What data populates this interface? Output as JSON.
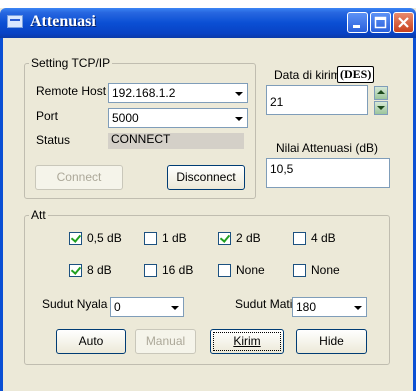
{
  "window": {
    "title": "Attenuasi",
    "controls": {
      "minimize": "minimize-icon",
      "maximize": "maximize-icon",
      "close": "close-icon"
    }
  },
  "tcp": {
    "legend": "Setting TCP/IP",
    "remote_host_label": "Remote Host",
    "remote_host_value": "192.168.1.2",
    "port_label": "Port",
    "port_value": "5000",
    "status_label": "Status",
    "status_value": "CONNECT",
    "connect_label": "Connect",
    "disconnect_label": "Disconnect"
  },
  "data_kirim": {
    "label": "Data di kirim",
    "badge": "(DES)",
    "value": "21"
  },
  "nilai": {
    "label": "Nilai Attenuasi (dB)",
    "value": "10,5"
  },
  "att": {
    "legend": "Att",
    "checks": [
      {
        "label": "0,5 dB",
        "checked": true
      },
      {
        "label": "1 dB",
        "checked": false
      },
      {
        "label": "2 dB",
        "checked": true
      },
      {
        "label": "4 dB",
        "checked": false
      },
      {
        "label": "8 dB",
        "checked": true
      },
      {
        "label": "16 dB",
        "checked": false
      },
      {
        "label": "None",
        "checked": false
      },
      {
        "label": "None",
        "checked": false
      }
    ],
    "sudut_nyala_label": "Sudut Nyala",
    "sudut_nyala_value": "0",
    "sudut_mati_label": "Sudut Mati",
    "sudut_mati_value": "180",
    "buttons": {
      "auto": "Auto",
      "manual": "Manual",
      "kirim": "Kirim",
      "hide": "Hide"
    }
  }
}
